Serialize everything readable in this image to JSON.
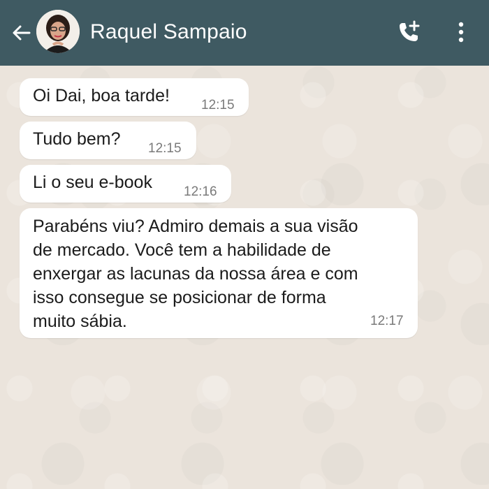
{
  "header": {
    "contact_name": "Raquel Sampaio",
    "back_icon": "arrow-left-icon",
    "call_icon": "add-call-icon",
    "menu_icon": "more-vertical-icon",
    "background_color": "#3f5a62"
  },
  "chat": {
    "background_color": "#ece5dd",
    "messages": [
      {
        "text": "Oi Dai, boa tarde!",
        "time": "12:15"
      },
      {
        "text": "Tudo bem?",
        "time": "12:15"
      },
      {
        "text": "Li o seu e-book",
        "time": "12:16"
      },
      {
        "text": "Parabéns viu? Admiro demais a sua visão\nde mercado. Você tem a habilidade de\nenxergar as lacunas da nossa área e com\nisso consegue se posicionar de forma\nmuito sábia.",
        "time": "12:17"
      }
    ]
  }
}
